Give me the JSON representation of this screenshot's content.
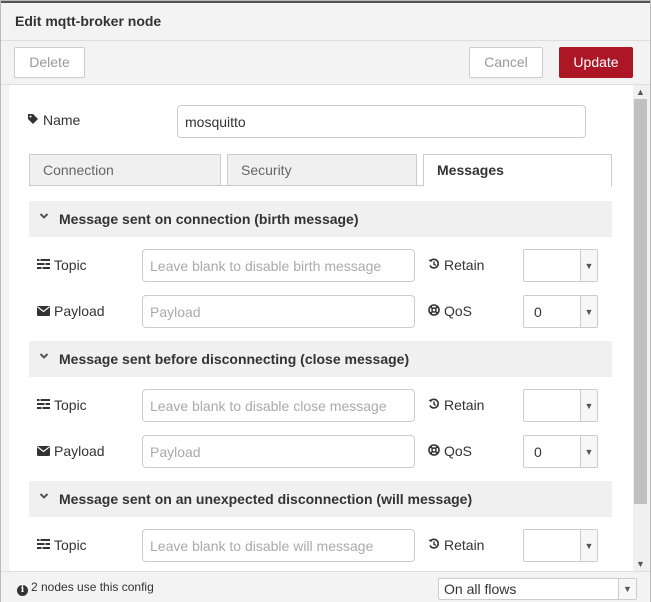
{
  "dialog": {
    "title": "Edit mqtt-broker node",
    "delete_label": "Delete",
    "cancel_label": "Cancel",
    "update_label": "Update"
  },
  "name": {
    "label": "Name",
    "value": "mosquitto"
  },
  "tabs": [
    {
      "label": "Connection",
      "active": false
    },
    {
      "label": "Security",
      "active": false
    },
    {
      "label": "Messages",
      "active": true
    }
  ],
  "sections": [
    {
      "title": "Message sent on connection (birth message)",
      "topic_label": "Topic",
      "topic_placeholder": "Leave blank to disable birth message",
      "payload_label": "Payload",
      "payload_placeholder": "Payload",
      "retain_label": "Retain",
      "retain_value": "",
      "qos_label": "QoS",
      "qos_value": "0"
    },
    {
      "title": "Message sent before disconnecting (close message)",
      "topic_label": "Topic",
      "topic_placeholder": "Leave blank to disable close message",
      "payload_label": "Payload",
      "payload_placeholder": "Payload",
      "retain_label": "Retain",
      "retain_value": "",
      "qos_label": "QoS",
      "qos_value": "0"
    },
    {
      "title": "Message sent on an unexpected disconnection (will message)",
      "topic_label": "Topic",
      "topic_placeholder": "Leave blank to disable will message",
      "retain_label": "Retain",
      "retain_value": ""
    }
  ],
  "footer": {
    "info": "2 nodes use this config",
    "scope_value": "On all flows"
  },
  "icons": {
    "tag": "tag-icon",
    "topic": "tasks-icon",
    "payload": "envelope-icon",
    "retain": "history-icon",
    "qos": "life-ring-icon",
    "chevron": "chevron-down-icon",
    "info": "info-circle-icon"
  },
  "colors": {
    "primary_button": "#ad1625",
    "section_header": "#f0f0f0"
  }
}
